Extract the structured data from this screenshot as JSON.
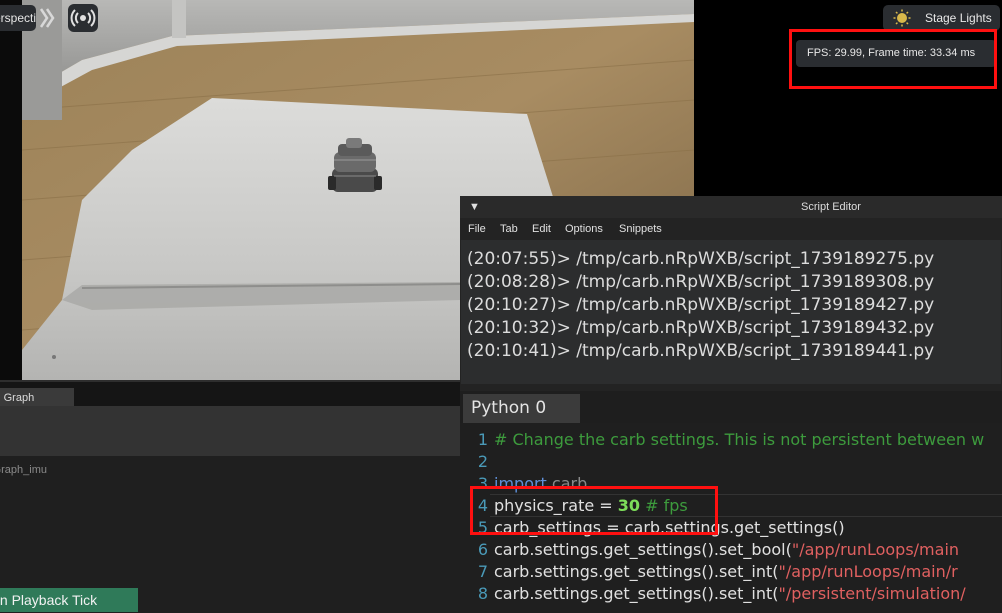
{
  "viewport": {
    "perspective_label": "Perspective",
    "stage_lights_label": "Stage Lights",
    "fps_text": "FPS: 29.99, Frame time: 33.34 ms"
  },
  "graph_panel": {
    "tab_label": "Action Graph",
    "graph_name": "ActionGraph_imu",
    "node_label": "On Playback Tick"
  },
  "script_editor": {
    "title": "Script Editor",
    "menu": [
      "File",
      "Tab",
      "Edit",
      "Options",
      "Snippets"
    ],
    "log": [
      "(20:07:55)> /tmp/carb.nRpWXB/script_1739189275.py",
      "(20:08:28)> /tmp/carb.nRpWXB/script_1739189308.py",
      "(20:10:27)> /tmp/carb.nRpWXB/script_1739189427.py",
      "(20:10:32)> /tmp/carb.nRpWXB/script_1739189432.py",
      "(20:10:41)> /tmp/carb.nRpWXB/script_1739189441.py"
    ],
    "tab_label": "Python 0",
    "code": {
      "line_numbers": [
        "1",
        "2",
        "3",
        "4",
        "5",
        "6",
        "7",
        "8"
      ],
      "l1_comment": "# Change the carb settings. This is not persistent between w",
      "l3_kw": "import",
      "l3_rest": " carb",
      "l4_name": "physics_rate",
      "l4_eq": " = ",
      "l4_num": "30",
      "l4_comment": " # fps",
      "l5": "carb_settings = carb.settings.get_settings()",
      "l6_code": "carb.settings.get_settings().set_bool(",
      "l6_str": "\"/app/runLoops/main",
      "l7_code": "carb.settings.get_settings().set_int(",
      "l7_str": "\"/app/runLoops/main/r",
      "l8_code": "carb.settings.get_settings().set_int(",
      "l8_str": "\"/persistent/simulation/"
    }
  },
  "colors": {
    "highlight": "#ff1010",
    "node_green": "#2f7a59",
    "comment_green": "#3d9b3d",
    "keyword_blue": "#5f8fd8",
    "number_green": "#7ddc5a",
    "string_red": "#e06060"
  }
}
